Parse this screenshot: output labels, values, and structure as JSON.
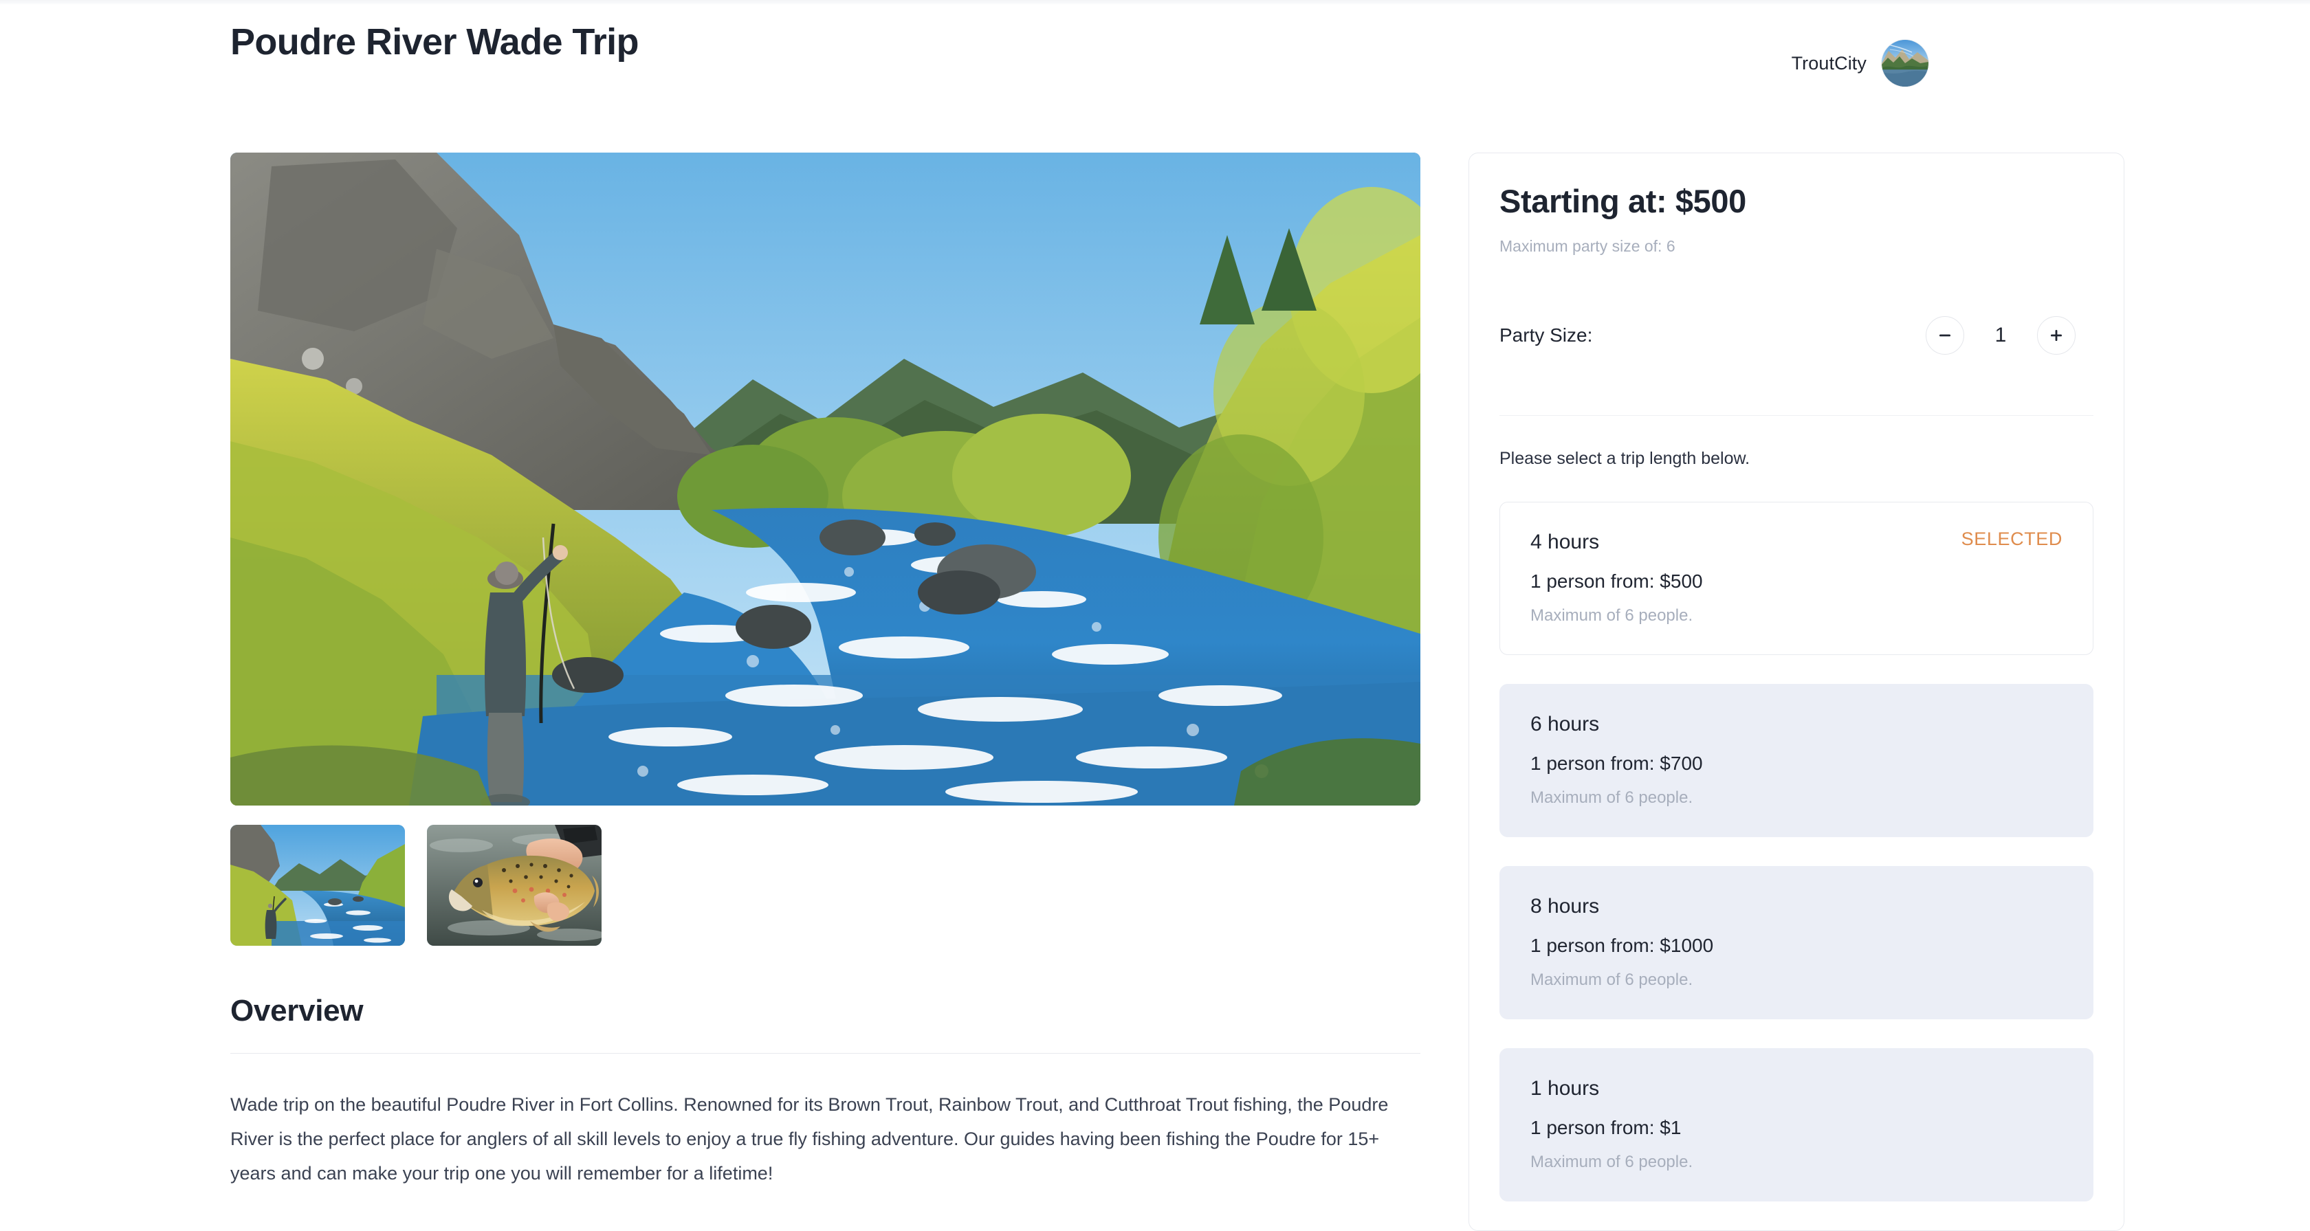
{
  "header": {
    "title": "Poudre River Wade Trip",
    "brand_name": "TroutCity",
    "avatar_alt": "troutcity-river-avatar"
  },
  "gallery": {
    "hero_alt": "angler-fly-fishing-poudre-river-canyon",
    "thumbnails": [
      {
        "alt": "poudre-river-canyon-angler-thumbnail"
      },
      {
        "alt": "hand-holding-brown-trout-thumbnail"
      }
    ]
  },
  "overview": {
    "heading": "Overview",
    "body": "Wade trip on the beautiful Poudre River in Fort Collins. Renowned for its Brown Trout, Rainbow Trout, and Cutthroat Trout fishing, the Poudre River is the perfect place for anglers of all skill levels to enjoy a true fly fishing adventure. Our guides having been fishing the Poudre for 15+ years and can make your trip one you will remember for a lifetime!"
  },
  "booking": {
    "price_heading": "Starting at: $500",
    "max_party_note": "Maximum party size of: 6",
    "party_label": "Party Size:",
    "party_value": "1",
    "decrement_icon": "minus-icon",
    "increment_icon": "plus-icon",
    "select_hint": "Please select a trip length below.",
    "options": [
      {
        "duration": "4 hours",
        "price": "1 person from: $500",
        "max": "Maximum of 6 people.",
        "badge": "SELECTED",
        "state": "selected"
      },
      {
        "duration": "6 hours",
        "price": "1 person from: $700",
        "max": "Maximum of 6 people.",
        "badge": "",
        "state": "unselected"
      },
      {
        "duration": "8 hours",
        "price": "1 person from: $1000",
        "max": "Maximum of 6 people.",
        "badge": "",
        "state": "unselected"
      },
      {
        "duration": "1 hours",
        "price": "1 person from: $1",
        "max": "Maximum of 6 people.",
        "badge": "",
        "state": "unselected"
      }
    ]
  },
  "colors": {
    "accent_selected": "#df8c4d",
    "card_unselected_bg": "#ebeef6",
    "text_primary": "#1f2430",
    "text_muted": "#a7aebc",
    "border": "#e8eaef"
  }
}
